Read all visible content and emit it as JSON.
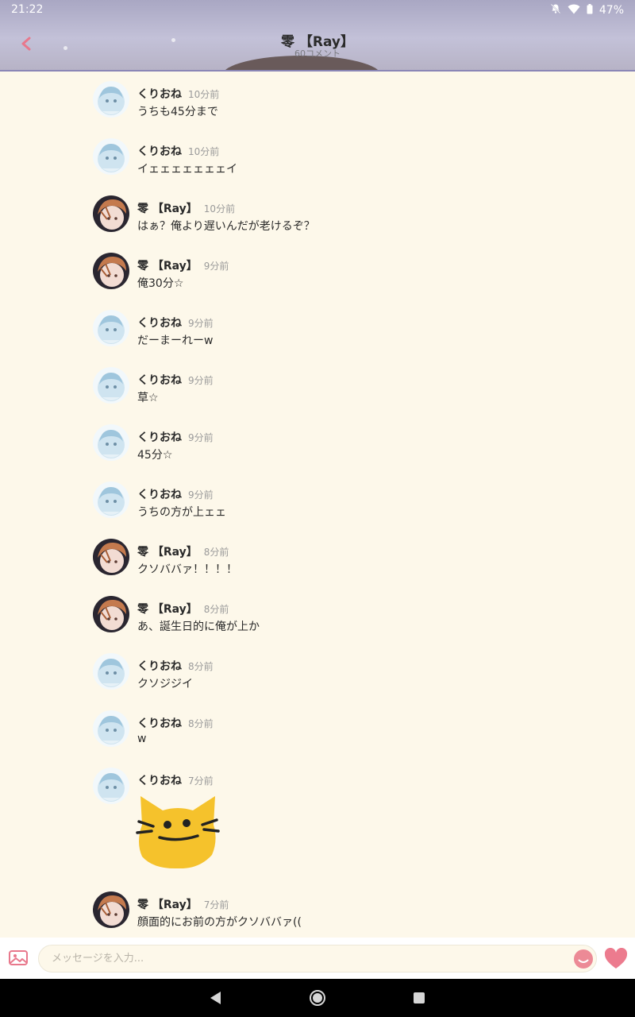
{
  "status_bar": {
    "time": "21:22",
    "battery": "47%",
    "icons": [
      "notifications-off-icon",
      "wifi-icon",
      "battery-icon"
    ]
  },
  "header": {
    "title": "零 【Ray】",
    "comment_count": "60コメント",
    "back_icon": "chevron-left-icon"
  },
  "colors": {
    "accent": "#e8788c",
    "background": "#fdf8ea",
    "sticker": "#f5c22c"
  },
  "messages": [
    {
      "user": "くりおね",
      "time": "10分前",
      "text": "うちも45分まで",
      "avatar": "kurione"
    },
    {
      "user": "くりおね",
      "time": "10分前",
      "text": "イェェェェェェェイ",
      "avatar": "kurione"
    },
    {
      "user": "零 【Ray】",
      "time": "10分前",
      "text": "はぁ？俺より遅いんだが老けるぞ？",
      "avatar": "ray"
    },
    {
      "user": "零 【Ray】",
      "time": "9分前",
      "text": "俺30分☆",
      "avatar": "ray"
    },
    {
      "user": "くりおね",
      "time": "9分前",
      "text": "だーまーれーw",
      "avatar": "kurione"
    },
    {
      "user": "くりおね",
      "time": "9分前",
      "text": "草☆",
      "avatar": "kurione"
    },
    {
      "user": "くりおね",
      "time": "9分前",
      "text": "45分☆",
      "avatar": "kurione"
    },
    {
      "user": "くりおね",
      "time": "9分前",
      "text": "うちの方が上ェェ",
      "avatar": "kurione"
    },
    {
      "user": "零 【Ray】",
      "time": "8分前",
      "text": "クソババァ！！！！",
      "avatar": "ray"
    },
    {
      "user": "零 【Ray】",
      "time": "8分前",
      "text": "あ、誕生日的に俺が上か",
      "avatar": "ray"
    },
    {
      "user": "くりおね",
      "time": "8分前",
      "text": "クソジジイ",
      "avatar": "kurione"
    },
    {
      "user": "くりおね",
      "time": "8分前",
      "text": "w",
      "avatar": "kurione"
    },
    {
      "user": "くりおね",
      "time": "7分前",
      "text": "",
      "avatar": "kurione",
      "sticker": "cat-face-sticker"
    },
    {
      "user": "零 【Ray】",
      "time": "7分前",
      "text": "顔面的にお前の方がクソババァ((",
      "avatar": "ray"
    }
  ],
  "input": {
    "placeholder": "メッセージを入力...",
    "value": ""
  },
  "toolbar_icons": [
    "image-icon",
    "emoji-icon",
    "heart-icon"
  ],
  "nav_icons": [
    "nav-back-icon",
    "nav-home-icon",
    "nav-recents-icon"
  ]
}
